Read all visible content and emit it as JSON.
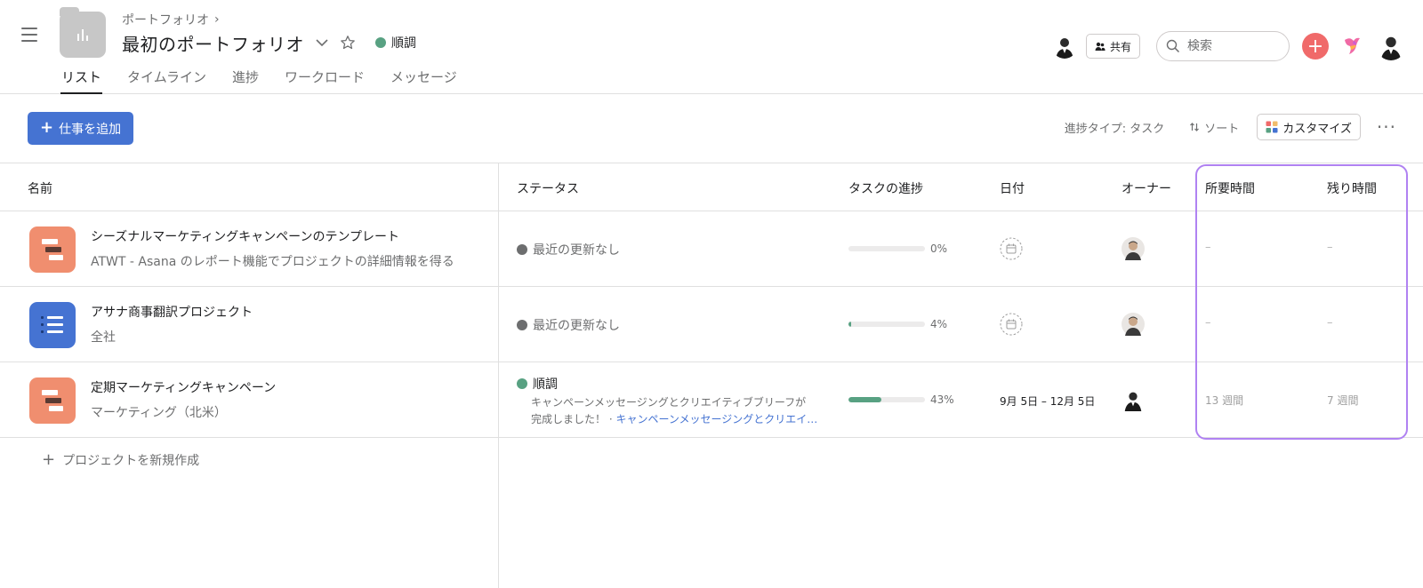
{
  "header": {
    "breadcrumb": "ポートフォリオ",
    "title": "最初のポートフォリオ",
    "status_label": "順調",
    "status_color": "#58a182",
    "tabs": [
      {
        "label": "リスト",
        "active": true
      },
      {
        "label": "タイムライン",
        "active": false
      },
      {
        "label": "進捗",
        "active": false
      },
      {
        "label": "ワークロード",
        "active": false
      },
      {
        "label": "メッセージ",
        "active": false
      }
    ],
    "share_label": "共有",
    "search_placeholder": "検索"
  },
  "toolbar": {
    "add_work_label": "仕事を追加",
    "progress_type_label": "進捗タイプ: タスク",
    "sort_label": "ソート",
    "customize_label": "カスタマイズ",
    "new_project_label": "プロジェクトを新規作成"
  },
  "table": {
    "columns": [
      "名前",
      "ステータス",
      "タスクの進捗",
      "日付",
      "オーナー",
      "所要時間",
      "残り時間"
    ],
    "rows": [
      {
        "name": "シーズナルマーケティングキャンペーンのテンプレート",
        "subtitle": "ATWT - Asana のレポート機能でプロジェクトの詳細情報を得る",
        "icon": "gantt-icon",
        "icon_color": "#f08e6f",
        "status": "最近の更新なし",
        "status_color": "#6d6e6f",
        "progress": 0,
        "progress_label": "0%",
        "date": "",
        "duration": "–",
        "remaining": "–"
      },
      {
        "name": "アサナ商事翻訳プロジェクト",
        "subtitle": "全社",
        "icon": "list-icon",
        "icon_color": "#4573d2",
        "status": "最近の更新なし",
        "status_color": "#6d6e6f",
        "progress": 4,
        "progress_label": "4%",
        "date": "",
        "duration": "–",
        "remaining": "–"
      },
      {
        "name": "定期マーケティングキャンペーン",
        "subtitle": "マーケティング（北米）",
        "icon": "gantt-icon",
        "icon_color": "#f08e6f",
        "status": "順調",
        "status_color": "#58a182",
        "status_note_1": "キャンペーンメッセージングとクリエイティブブリーフが",
        "status_note_2": "完成しました！ · ",
        "status_note_link": "キャンペーンメッセージングとクリエイ…",
        "progress": 43,
        "progress_label": "43%",
        "date": "9月 5日 – 12月 5日",
        "duration": "13 週間",
        "remaining": "7 週間"
      }
    ]
  }
}
